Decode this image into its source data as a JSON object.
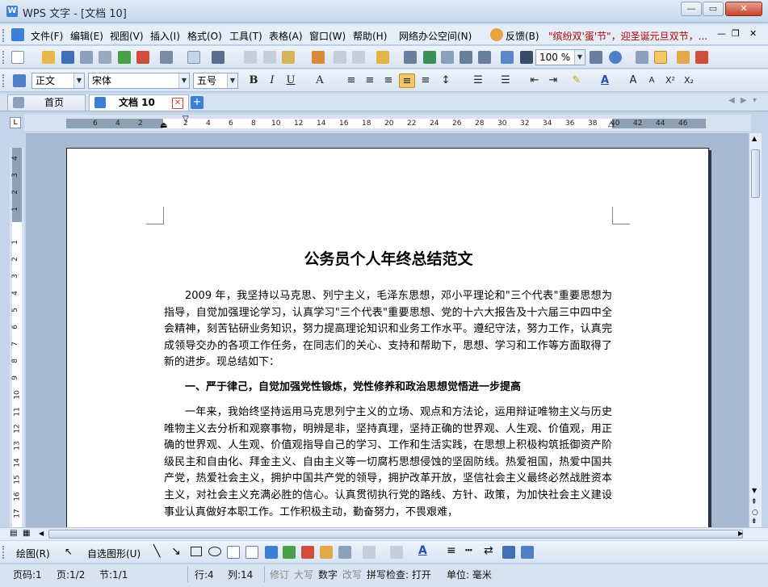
{
  "window": {
    "title": "WPS 文字 - [文档 10]",
    "app_icon_letter": "W"
  },
  "menu": {
    "items": [
      "文件(F)",
      "编辑(E)",
      "视图(V)",
      "插入(I)",
      "格式(O)",
      "工具(T)",
      "表格(A)",
      "窗口(W)",
      "帮助(H)",
      "网络办公空间(N)",
      "反馈(B)"
    ],
    "promo": "\"缤纷双'蛋'节\"，迎圣诞元旦双节，..."
  },
  "toolbar": {
    "zoom": "100 %"
  },
  "format": {
    "style": "正文",
    "font": "宋体",
    "size": "五号"
  },
  "tabs": {
    "home": "首页",
    "doc": "文档 10"
  },
  "ruler": {
    "h_numbers": [
      "6",
      "4",
      "2",
      "2",
      "4",
      "6",
      "8",
      "10",
      "12",
      "14",
      "16",
      "18",
      "20",
      "22",
      "24",
      "26",
      "28",
      "30",
      "32",
      "34",
      "36",
      "38",
      "40",
      "42",
      "44",
      "46"
    ],
    "v_numbers": [
      "4",
      "3",
      "2",
      "1",
      "1",
      "2",
      "3",
      "4",
      "5",
      "6",
      "7",
      "8",
      "9",
      "10",
      "11",
      "12",
      "13",
      "14",
      "15",
      "16",
      "17"
    ]
  },
  "document": {
    "title": "公务员个人年终总结范文",
    "paragraphs": [
      "2009 年，我坚持以马克思、列宁主义，毛泽东思想，邓小平理论和\"三个代表\"重要思想为指导，自觉加强理论学习，认真学习\"三个代表\"重要思想、党的十六大报告及十六届三中四中全会精神，刻苦钻研业务知识，努力提高理论知识和业务工作水平。遵纪守法，努力工作，认真完成领导交办的各项工作任务，在同志们的关心、支持和帮助下，思想、学习和工作等方面取得了新的进步。现总结如下：",
      "一、严于律己，自觉加强党性锻炼，党性修养和政治思想觉悟进一步提高",
      "一年来，我始终坚持运用马克思列宁主义的立场、观点和方法论，运用辩证唯物主义与历史唯物主义去分析和观察事物，明辨是非，坚持真理，坚持正确的世界观、人生观、价值观，用正确的世界观、人生观、价值观指导自己的学习、工作和生活实践，在思想上积极构筑抵御资产阶级民主和自由化、拜金主义、自由主义等一切腐朽思想侵蚀的坚固防线。热爱祖国，热爱中国共产党，热爱社会主义，拥护中国共产党的领导，拥护改革开放，坚信社会主义最终必然战胜资本主义，对社会主义充满必胜的信心。认真贯彻执行党的路线、方针、政策，为加快社会主义建设事业认真做好本职工作。工作积极主动，勤奋努力，不畏艰难，"
    ]
  },
  "drawbar": {
    "draw": "绘图(R)",
    "autoshape": "自选图形(U)"
  },
  "status": {
    "page_code": "页码:1",
    "page": "页:1/2",
    "section": "节:1/1",
    "line": "行:4",
    "column": "列:14",
    "revise": "修订",
    "caps": "大写",
    "num": "数字",
    "overwrite": "改写",
    "spell": "拼写检查: 打开",
    "unit": "单位: 毫米"
  }
}
